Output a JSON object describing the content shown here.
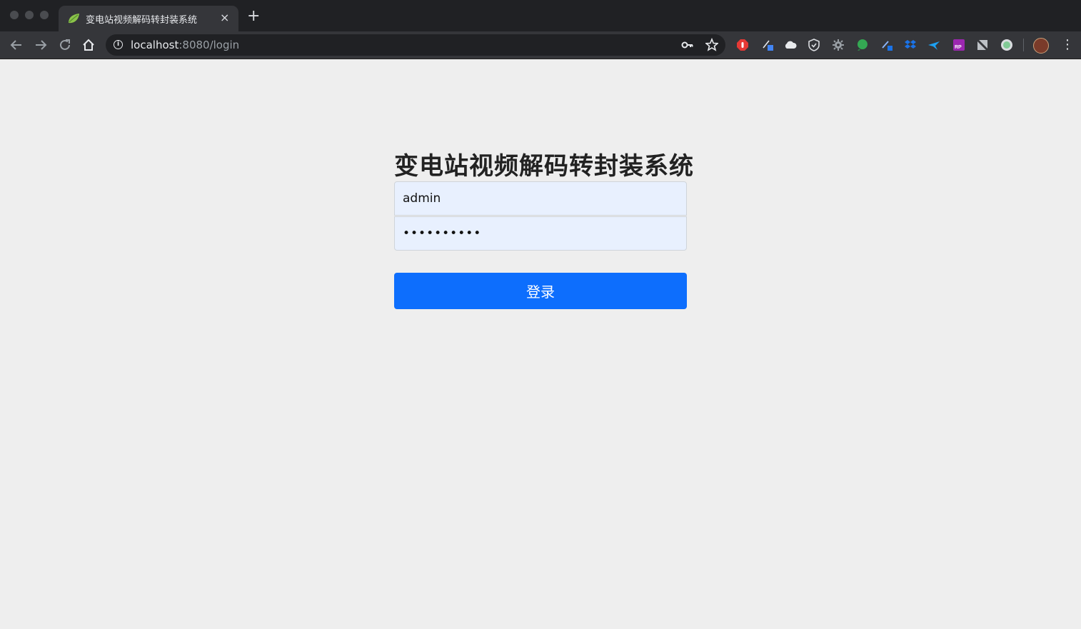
{
  "browser": {
    "tab_title": "变电站视频解码转封装系统",
    "tab_close": "×",
    "new_tab": "+",
    "url_host": "localhost",
    "url_rest": ":8080/login",
    "icons": {
      "favicon": "spring-leaf-icon",
      "back": "back-arrow-icon",
      "forward": "forward-arrow-icon",
      "reload": "reload-icon",
      "home": "home-icon",
      "info": "info-icon",
      "key": "key-icon",
      "star": "star-icon",
      "menu": "more-vert-icon"
    },
    "extension_colors": [
      "#e53935",
      "#4285f4",
      "#e8eaed",
      "#dadce0",
      "#9aa0a6",
      "#34a853",
      "#8ab4f8",
      "#1a73e8",
      "#1da1f2",
      "#9c27b0",
      "#bdc1c6",
      "#81c995"
    ]
  },
  "login": {
    "title": "变电站视频解码转封装系统",
    "username_value": "admin",
    "password_value": "••••••••••",
    "submit_label": "登录"
  },
  "colors": {
    "page_bg": "#eeeeee",
    "input_bg": "#e8f0fe",
    "button_bg": "#0d6efd",
    "title_text": "#222222"
  }
}
